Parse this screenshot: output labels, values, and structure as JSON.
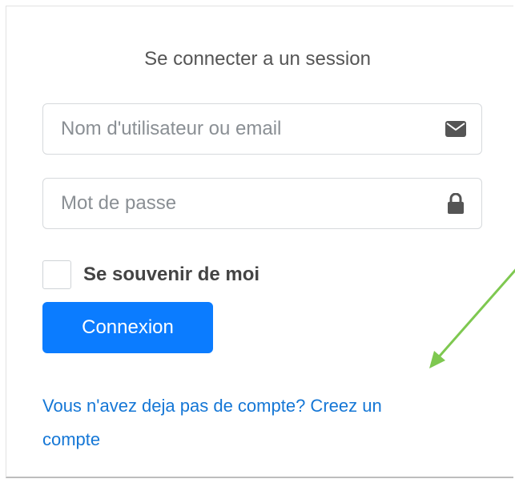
{
  "login": {
    "title": "Se connecter a un session",
    "username_placeholder": "Nom d'utilisateur ou email",
    "username_value": "",
    "password_placeholder": "Mot de passe",
    "password_value": "",
    "remember_label": "Se souvenir de moi",
    "remember_checked": false,
    "submit_label": "Connexion",
    "signup_link": "Vous n'avez deja pas de compte? Creez un compte"
  },
  "icons": {
    "email": "envelope-icon",
    "password": "lock-icon",
    "annotation": "green-arrow"
  },
  "colors": {
    "primary": "#0b7cff",
    "link": "#1577d6",
    "annotation_arrow": "#7ec850"
  }
}
